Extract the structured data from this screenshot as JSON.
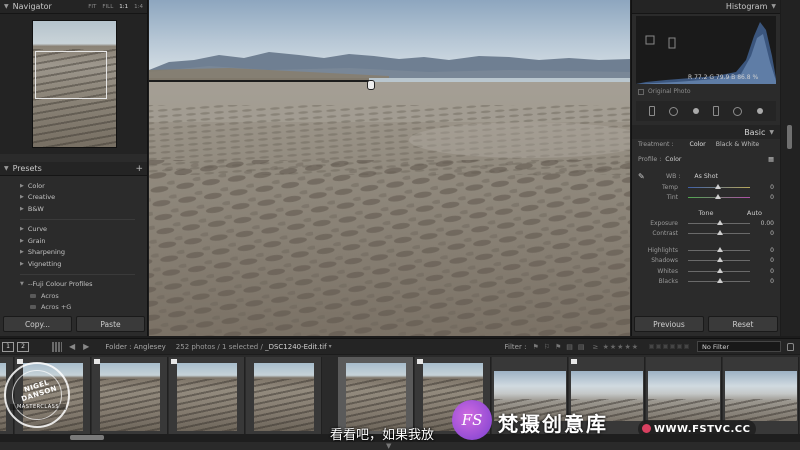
{
  "left": {
    "navigator_title": "Navigator",
    "zoom_options": [
      "FIT",
      "FILL",
      "1:1",
      "1:4"
    ],
    "presets_title": "Presets",
    "preset_items": [
      "Color",
      "Creative",
      "B&W",
      "Curve",
      "Grain",
      "Sharpening",
      "Vignetting"
    ],
    "preset_folder": "--Fuji Colour Profiles",
    "preset_subitems": [
      "Acros",
      "Acros +G"
    ],
    "copy_label": "Copy...",
    "paste_label": "Paste"
  },
  "right": {
    "histogram_title": "Histogram",
    "rgb_readout": "R  77.2   G  79.9   B  86.8  %",
    "original_photo_label": "Original Photo",
    "basic_title": "Basic",
    "treatment_label": "Treatment :",
    "treatment_color": "Color",
    "treatment_bw": "Black & White",
    "profile_label": "Profile :",
    "profile_value": "Color",
    "wb_label": "WB :",
    "wb_value": "As Shot",
    "sliders_wb": [
      {
        "label": "Temp",
        "value": "0"
      },
      {
        "label": "Tint",
        "value": "0"
      }
    ],
    "tone_title": "Tone",
    "auto_label": "Auto",
    "sliders_tone": [
      {
        "label": "Exposure",
        "value": "0.00"
      },
      {
        "label": "Contrast",
        "value": "0"
      }
    ],
    "sliders_presence": [
      {
        "label": "Highlights",
        "value": "0"
      },
      {
        "label": "Shadows",
        "value": "0"
      },
      {
        "label": "Whites",
        "value": "0"
      },
      {
        "label": "Blacks",
        "value": "0"
      }
    ],
    "previous_label": "Previous",
    "reset_label": "Reset"
  },
  "filmbar": {
    "monitor1": "1",
    "monitor2": "2",
    "folder": "Folder : Anglesey",
    "count": "252 photos / 1 selected /",
    "filename": "_DSC1240-Edit.tif",
    "filter_label": "Filter :",
    "no_filter": "No Filter"
  },
  "overlays": {
    "watermark_name": "NIGEL DANSON",
    "watermark_sub": "MASTERCLASS",
    "subtitle": "看看吧，如果我放",
    "logo_letters": "FS",
    "logo_text": "梵摄创意库",
    "url": "WWW.FSTVC.CC"
  }
}
